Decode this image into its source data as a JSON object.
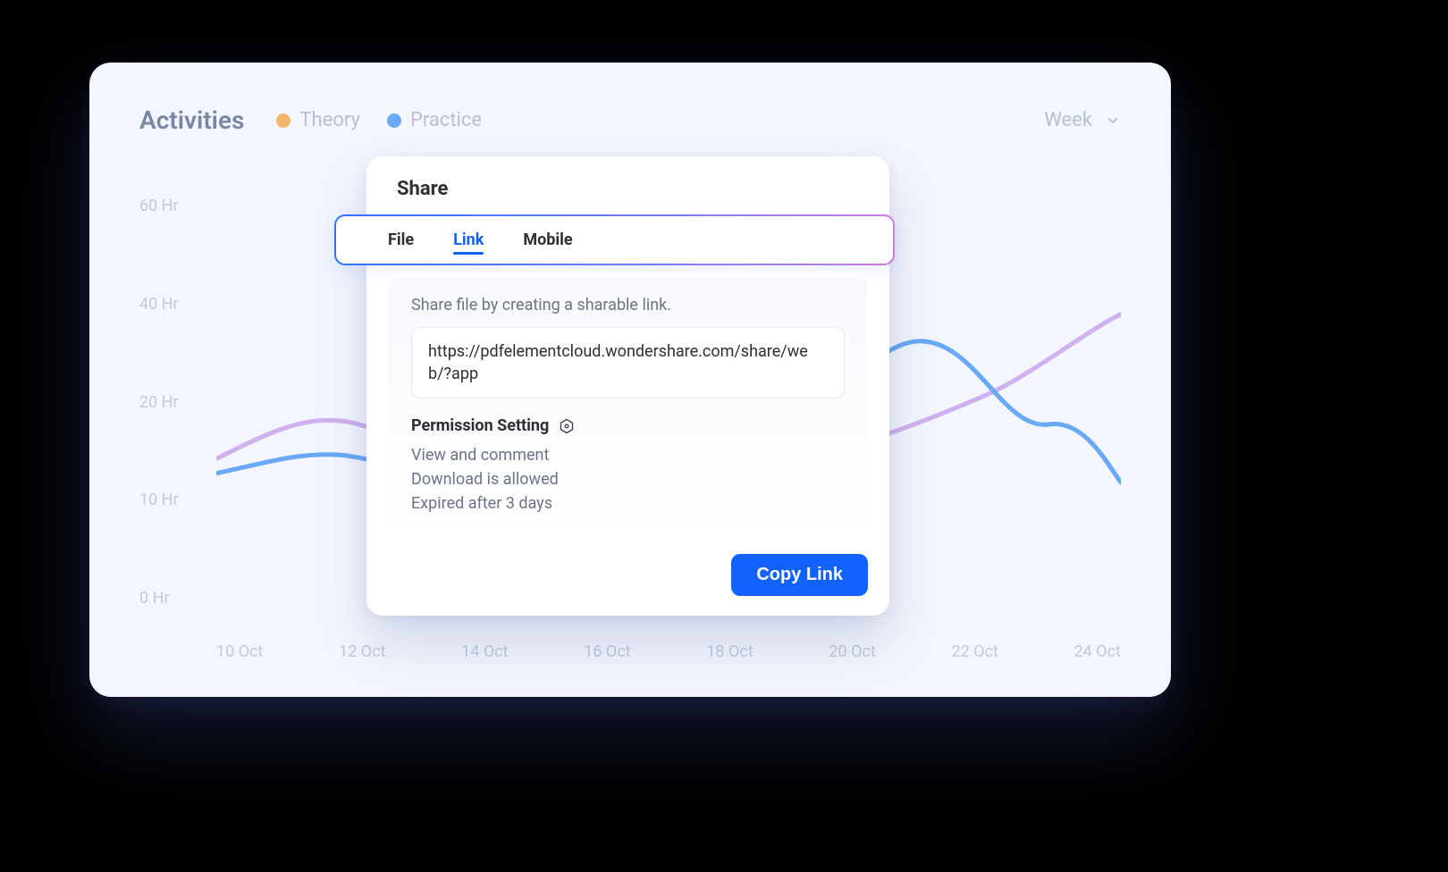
{
  "header": {
    "title": "Activities",
    "legend": {
      "theory": "Theory",
      "practice": "Practice"
    },
    "range": "Week"
  },
  "chart_data": {
    "type": "line",
    "title": "Activities",
    "xlabel": "",
    "ylabel": "",
    "ylim": [
      0,
      60
    ],
    "y_ticks": [
      "60 Hr",
      "40 Hr",
      "20 Hr",
      "10 Hr",
      "0 Hr"
    ],
    "categories": [
      "10 Oct",
      "12 Oct",
      "14 Oct",
      "16 Oct",
      "18 Oct",
      "20 Oct",
      "22 Oct",
      "24 Oct"
    ],
    "series": [
      {
        "name": "Theory",
        "color": "#c9a8e8",
        "values": [
          22,
          26,
          20,
          18,
          20,
          30,
          34,
          44
        ]
      },
      {
        "name": "Practice",
        "color": "#6aa9f7",
        "values": [
          20,
          22,
          19,
          18,
          22,
          38,
          26,
          22
        ]
      }
    ]
  },
  "share": {
    "title": "Share",
    "tabs": {
      "file": "File",
      "link": "Link",
      "mobile": "Mobile"
    },
    "active_tab": "link",
    "description": "Share file by creating a sharable link.",
    "link": "https://pdfelementcloud.wondershare.com/share/web/?app",
    "permission_heading": "Permission Setting",
    "permissions": {
      "view": "View and comment",
      "download": "Download is allowed",
      "expiry": "Expired after 3 days"
    },
    "copy_button": "Copy Link"
  }
}
